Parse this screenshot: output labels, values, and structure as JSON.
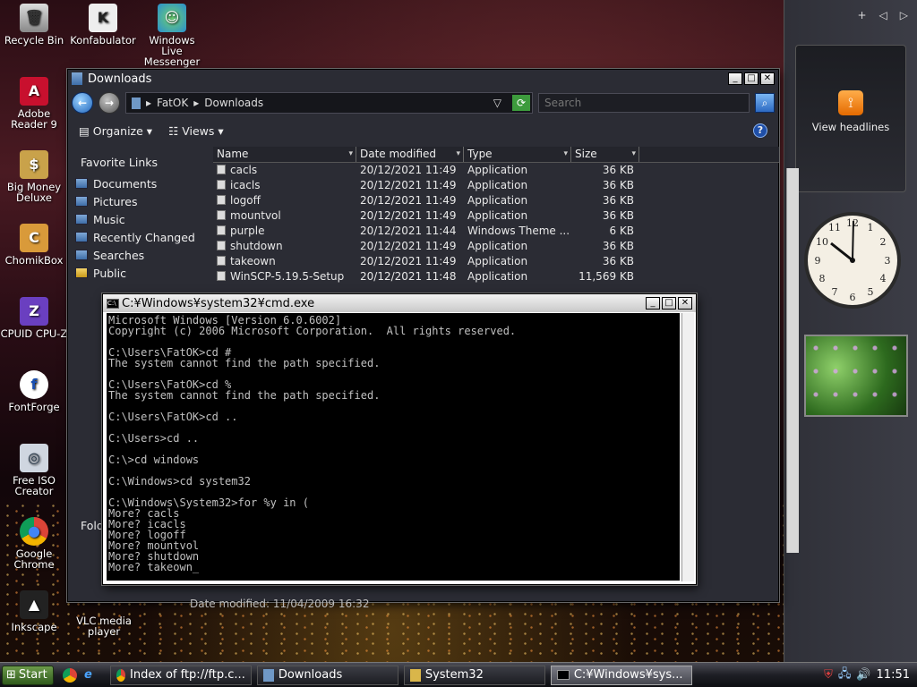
{
  "desktop_icons": [
    {
      "label": "Recycle Bin",
      "icon": "recycle-bin-icon"
    },
    {
      "label": "Konfabulator",
      "icon": "konfabulator-icon"
    },
    {
      "label": "Windows Live Messenger",
      "icon": "messenger-icon"
    },
    {
      "label": "Adobe Reader 9",
      "icon": "adobe-reader-icon"
    },
    {
      "label": "Big Money Deluxe",
      "icon": "big-money-icon"
    },
    {
      "label": "ChomikBox",
      "icon": "chomikbox-icon"
    },
    {
      "label": "CPUID CPU-Z",
      "icon": "cpuz-icon"
    },
    {
      "label": "FontForge",
      "icon": "fontforge-icon"
    },
    {
      "label": "Free ISO Creator",
      "icon": "iso-creator-icon"
    },
    {
      "label": "Google Chrome",
      "icon": "chrome-icon"
    },
    {
      "label": "Inkscape",
      "icon": "inkscape-icon"
    },
    {
      "label": "VLC media player",
      "icon": "vlc-icon"
    }
  ],
  "sidebar": {
    "add": "+",
    "prev": "◁",
    "next": "▷",
    "feed_label": "View headlines"
  },
  "explorer": {
    "title": "Downloads",
    "breadcrumb": [
      "FatOK",
      "Downloads"
    ],
    "search_placeholder": "Search",
    "toolbar": {
      "organize": "Organize",
      "views": "Views"
    },
    "nav": {
      "header": "Favorite Links",
      "items": [
        "Documents",
        "Pictures",
        "Music",
        "Recently Changed",
        "Searches",
        "Public"
      ]
    },
    "columns": [
      "Name",
      "Date modified",
      "Type",
      "Size"
    ],
    "rows": [
      [
        "cacls",
        "20/12/2021 11:49",
        "Application",
        "36 KB"
      ],
      [
        "icacls",
        "20/12/2021 11:49",
        "Application",
        "36 KB"
      ],
      [
        "logoff",
        "20/12/2021 11:49",
        "Application",
        "36 KB"
      ],
      [
        "mountvol",
        "20/12/2021 11:49",
        "Application",
        "36 KB"
      ],
      [
        "purple",
        "20/12/2021 11:44",
        "Windows Theme ...",
        "6 KB"
      ],
      [
        "shutdown",
        "20/12/2021 11:49",
        "Application",
        "36 KB"
      ],
      [
        "takeown",
        "20/12/2021 11:49",
        "Application",
        "36 KB"
      ],
      [
        "WinSCP-5.19.5-Setup",
        "20/12/2021 11:48",
        "Application",
        "11,569 KB"
      ]
    ],
    "details_label": "Fold",
    "date_line": "Date modified: 11/04/2009 16:32"
  },
  "cmd": {
    "title": "C:¥Windows¥system32¥cmd.exe",
    "lines": [
      "Microsoft Windows [Version 6.0.6002]",
      "Copyright (c) 2006 Microsoft Corporation.  All rights reserved.",
      "",
      "C:\\Users\\FatOK>cd #",
      "The system cannot find the path specified.",
      "",
      "C:\\Users\\FatOK>cd %",
      "The system cannot find the path specified.",
      "",
      "C:\\Users\\FatOK>cd ..",
      "",
      "C:\\Users>cd ..",
      "",
      "C:\\>cd windows",
      "",
      "C:\\Windows>cd system32",
      "",
      "C:\\Windows\\System32>for %y in (",
      "More? cacls",
      "More? icacls",
      "More? logoff",
      "More? mountvol",
      "More? shutdown",
      "More? takeown_"
    ]
  },
  "taskbar": {
    "start": "Start",
    "tasks": [
      "Index of ftp://ftp.c...",
      "Downloads",
      "System32",
      "C:¥Windows¥sys..."
    ],
    "clock": "11:51"
  }
}
